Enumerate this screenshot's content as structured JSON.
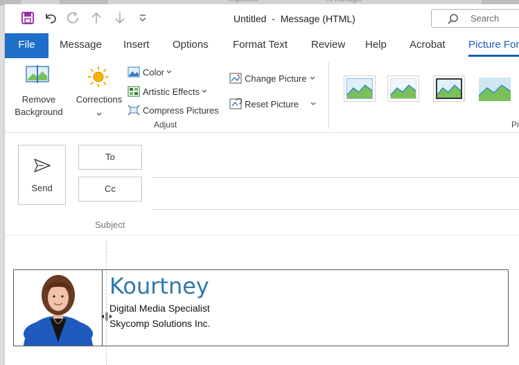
{
  "window": {
    "title": "Untitled  -  Message (HTML)",
    "search_placeholder": "Search"
  },
  "quick_access": [
    "save-icon",
    "undo-icon",
    "redo-icon",
    "up-arrow-icon",
    "down-arrow-icon",
    "customize-qat-icon"
  ],
  "tabs": [
    {
      "label": "File"
    },
    {
      "label": "Message"
    },
    {
      "label": "Insert"
    },
    {
      "label": "Options"
    },
    {
      "label": "Format Text"
    },
    {
      "label": "Review"
    },
    {
      "label": "Help"
    },
    {
      "label": "Acrobat"
    },
    {
      "label": "Picture Format"
    }
  ],
  "ribbon": {
    "remove_background": "Remove\nBackground",
    "corrections": "Corrections",
    "color": "Color",
    "artistic_effects": "Artistic Effects",
    "compress_pictures": "Compress Pictures",
    "change_picture": "Change Picture",
    "reset_picture": "Reset Picture",
    "adjust_group": "Adjust",
    "styles_group_partial": "Pi"
  },
  "compose": {
    "send_label": "Send",
    "to_label": "To",
    "cc_label": "Cc",
    "subject_label": "Subject"
  },
  "signature": {
    "name": "Kourtney",
    "title": "Digital Media Specialist",
    "company": "Skycomp Solutions Inc."
  },
  "colors": {
    "accent": "#1a5fb4",
    "file_tab": "#1d6fc9",
    "signature_name": "#2e78ad"
  }
}
